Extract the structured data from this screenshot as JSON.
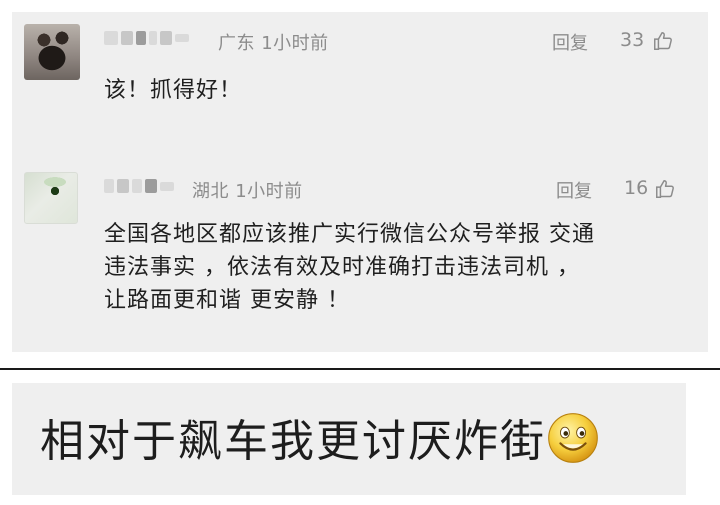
{
  "comments": [
    {
      "region": "广东",
      "time": "1小时前",
      "reply_label": "回复",
      "likes": "33",
      "text": "该！抓得好！",
      "avatar_icon": "blurred-avatar",
      "name": "blurred-username"
    },
    {
      "region": "湖北",
      "time": "1小时前",
      "reply_label": "回复",
      "likes": "16",
      "text_lines": [
        "全国各地区都应该推广实行微信公众号举报 交通",
        "违法事实 ，依法有效及时准确打击违法司机 ，",
        "让路面更和谐 更安静 ！"
      ],
      "avatar_icon": "blurred-avatar",
      "name": "blurred-username"
    }
  ],
  "bottom_comment": {
    "text": "相对于飙车我更讨厌炸街",
    "emoji_icon": "grinning-face-emoji"
  },
  "colors": {
    "panel_bg": "#efefef",
    "meta_gray": "#8c8c8c",
    "text_dark": "#1f1f1f"
  }
}
